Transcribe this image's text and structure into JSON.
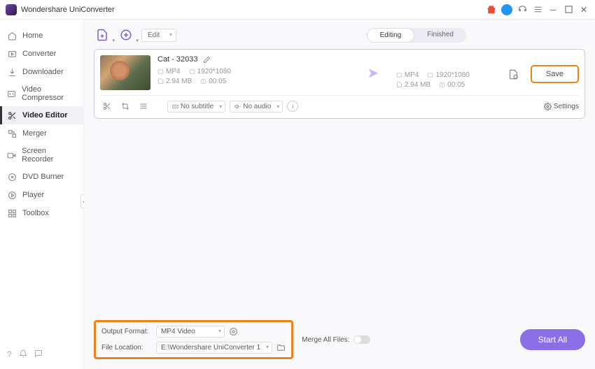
{
  "titlebar": {
    "title": "Wondershare UniConverter"
  },
  "sidebar": {
    "items": [
      {
        "label": "Home"
      },
      {
        "label": "Converter"
      },
      {
        "label": "Downloader"
      },
      {
        "label": "Video Compressor"
      },
      {
        "label": "Video Editor"
      },
      {
        "label": "Merger"
      },
      {
        "label": "Screen Recorder"
      },
      {
        "label": "DVD Burner"
      },
      {
        "label": "Player"
      },
      {
        "label": "Toolbox"
      }
    ]
  },
  "toolbar": {
    "edit_label": "Edit"
  },
  "tabs": {
    "editing": "Editing",
    "finished": "Finished"
  },
  "item": {
    "title": "Cat - 32033",
    "source": {
      "format": "MP4",
      "resolution": "1920*1080",
      "size": "2.94 MB",
      "duration": "00:05"
    },
    "target": {
      "format": "MP4",
      "resolution": "1920*1080",
      "size": "2.94 MB",
      "duration": "00:05"
    },
    "subtitle": "No subtitle",
    "audio": "No audio",
    "save": "Save",
    "settings": "Settings"
  },
  "bottom": {
    "output_format_label": "Output Format:",
    "output_format_value": "MP4 Video",
    "file_location_label": "File Location:",
    "file_location_value": "E:\\Wondershare UniConverter 1",
    "merge_label": "Merge All Files:",
    "start": "Start All"
  }
}
